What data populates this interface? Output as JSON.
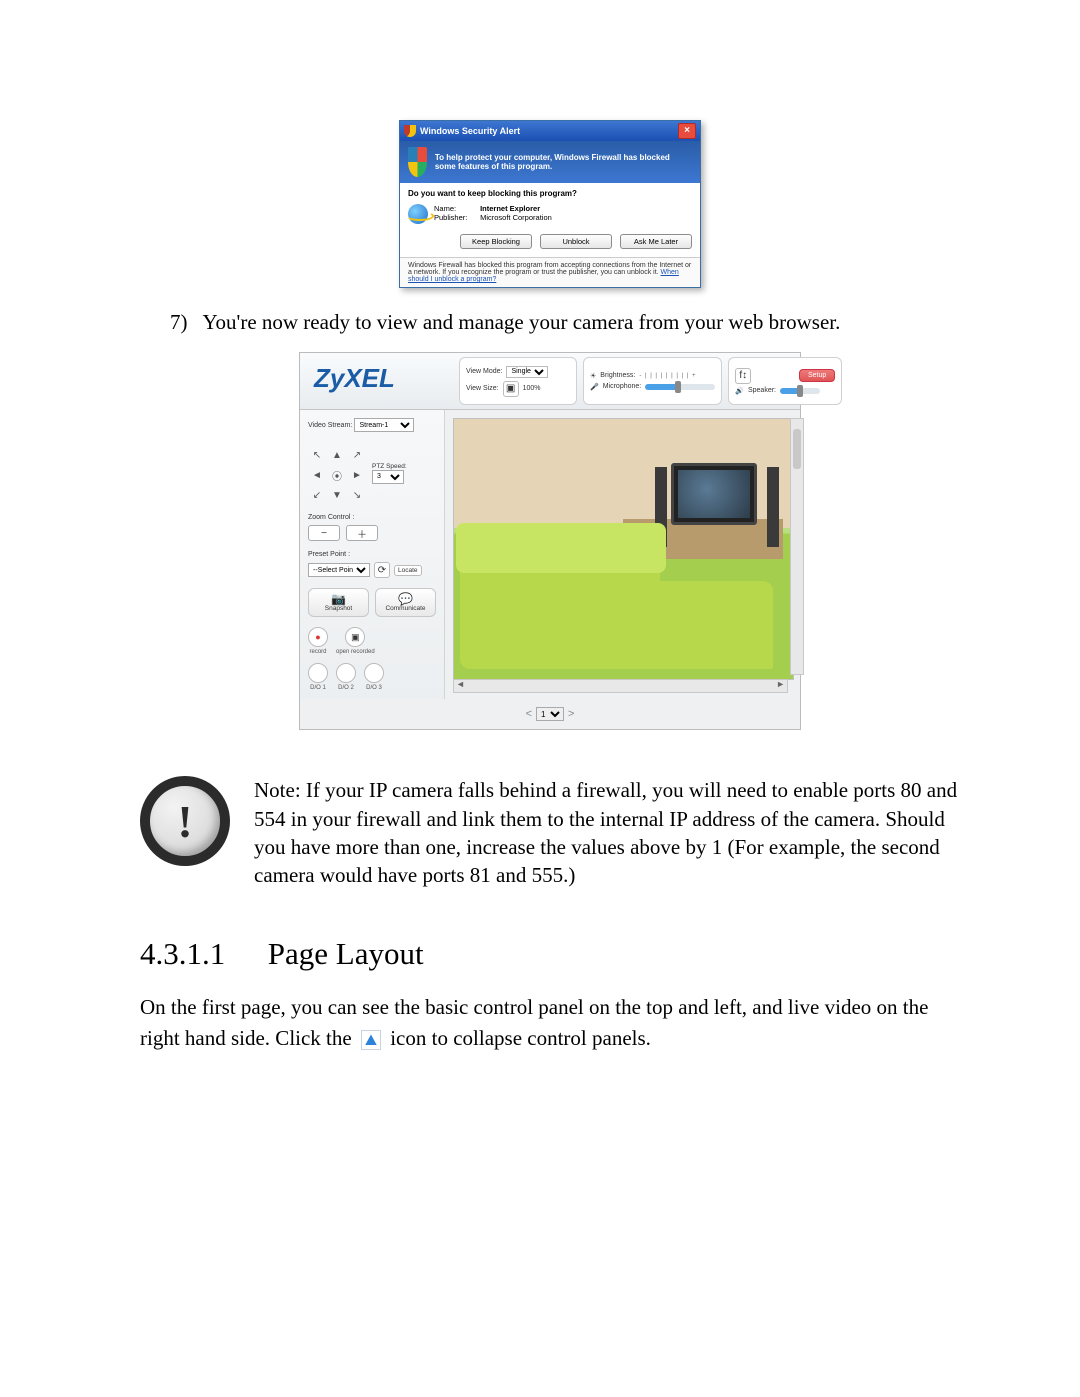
{
  "wsa": {
    "title": "Windows Security Alert",
    "banner": "To help protect your computer, Windows Firewall has blocked some features of this program.",
    "question": "Do you want to keep blocking this program?",
    "name_label": "Name:",
    "name_value": "Internet Explorer",
    "publisher_label": "Publisher:",
    "publisher_value": "Microsoft Corporation",
    "btn_keep": "Keep Blocking",
    "btn_unblock": "Unblock",
    "btn_ask": "Ask Me Later",
    "footer_text": "Windows Firewall has blocked this program from accepting connections from the Internet or a network. If you recognize the program or trust the publisher, you can unblock it. ",
    "footer_link": "When should I unblock a program?"
  },
  "step7": {
    "num": "7)",
    "text": "You're now ready to view and manage your camera from your web browser."
  },
  "cam": {
    "logo": "ZyXEL",
    "view_mode_label": "View Mode:",
    "view_mode_value": "Single",
    "view_size_label": "View Size:",
    "view_size_value": "100%",
    "brightness_label": "Brightness:",
    "microphone_label": "Microphone:",
    "speaker_label": "Speaker:",
    "setup_btn": "Setup",
    "video_stream_label": "Video Stream:",
    "video_stream_value": "Stream-1",
    "ptz_speed_label": "PTZ Speed:",
    "ptz_speed_value": "3",
    "zoom_label": "Zoom Control :",
    "preset_label": "Preset Point :",
    "preset_value": "--Select Point--",
    "preset_goto": "Locate",
    "snapshot": "Snapshot",
    "communicate": "Communicate",
    "record": "record",
    "open_recorded": "open recorded",
    "dio1": "D/O 1",
    "dio2": "D/O 2",
    "dio3": "D/O 3",
    "page_value": "1"
  },
  "note": {
    "text": "Note: If your IP camera falls behind a firewall, you will need to enable ports 80 and 554 in your firewall and link them to the internal IP address of the camera. Should you have more than one, increase the values above by 1 (For example, the second camera would have ports 81 and 555.)"
  },
  "heading": {
    "num": "4.3.1.1",
    "title": "Page Layout"
  },
  "para": {
    "before": "On the first page, you can see the basic control panel on the top and left, and live video on the right hand side. Click the ",
    "after": " icon to collapse control panels."
  }
}
